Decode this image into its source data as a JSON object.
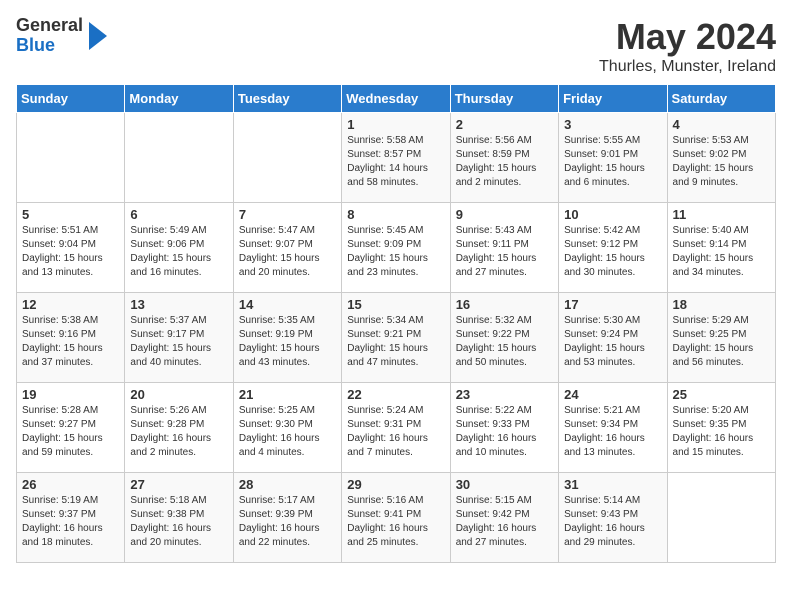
{
  "header": {
    "logo_general": "General",
    "logo_blue": "Blue",
    "month_title": "May 2024",
    "subtitle": "Thurles, Munster, Ireland"
  },
  "days_of_week": [
    "Sunday",
    "Monday",
    "Tuesday",
    "Wednesday",
    "Thursday",
    "Friday",
    "Saturday"
  ],
  "weeks": [
    [
      {
        "day": "",
        "info": ""
      },
      {
        "day": "",
        "info": ""
      },
      {
        "day": "",
        "info": ""
      },
      {
        "day": "1",
        "info": "Sunrise: 5:58 AM\nSunset: 8:57 PM\nDaylight: 14 hours\nand 58 minutes."
      },
      {
        "day": "2",
        "info": "Sunrise: 5:56 AM\nSunset: 8:59 PM\nDaylight: 15 hours\nand 2 minutes."
      },
      {
        "day": "3",
        "info": "Sunrise: 5:55 AM\nSunset: 9:01 PM\nDaylight: 15 hours\nand 6 minutes."
      },
      {
        "day": "4",
        "info": "Sunrise: 5:53 AM\nSunset: 9:02 PM\nDaylight: 15 hours\nand 9 minutes."
      }
    ],
    [
      {
        "day": "5",
        "info": "Sunrise: 5:51 AM\nSunset: 9:04 PM\nDaylight: 15 hours\nand 13 minutes."
      },
      {
        "day": "6",
        "info": "Sunrise: 5:49 AM\nSunset: 9:06 PM\nDaylight: 15 hours\nand 16 minutes."
      },
      {
        "day": "7",
        "info": "Sunrise: 5:47 AM\nSunset: 9:07 PM\nDaylight: 15 hours\nand 20 minutes."
      },
      {
        "day": "8",
        "info": "Sunrise: 5:45 AM\nSunset: 9:09 PM\nDaylight: 15 hours\nand 23 minutes."
      },
      {
        "day": "9",
        "info": "Sunrise: 5:43 AM\nSunset: 9:11 PM\nDaylight: 15 hours\nand 27 minutes."
      },
      {
        "day": "10",
        "info": "Sunrise: 5:42 AM\nSunset: 9:12 PM\nDaylight: 15 hours\nand 30 minutes."
      },
      {
        "day": "11",
        "info": "Sunrise: 5:40 AM\nSunset: 9:14 PM\nDaylight: 15 hours\nand 34 minutes."
      }
    ],
    [
      {
        "day": "12",
        "info": "Sunrise: 5:38 AM\nSunset: 9:16 PM\nDaylight: 15 hours\nand 37 minutes."
      },
      {
        "day": "13",
        "info": "Sunrise: 5:37 AM\nSunset: 9:17 PM\nDaylight: 15 hours\nand 40 minutes."
      },
      {
        "day": "14",
        "info": "Sunrise: 5:35 AM\nSunset: 9:19 PM\nDaylight: 15 hours\nand 43 minutes."
      },
      {
        "day": "15",
        "info": "Sunrise: 5:34 AM\nSunset: 9:21 PM\nDaylight: 15 hours\nand 47 minutes."
      },
      {
        "day": "16",
        "info": "Sunrise: 5:32 AM\nSunset: 9:22 PM\nDaylight: 15 hours\nand 50 minutes."
      },
      {
        "day": "17",
        "info": "Sunrise: 5:30 AM\nSunset: 9:24 PM\nDaylight: 15 hours\nand 53 minutes."
      },
      {
        "day": "18",
        "info": "Sunrise: 5:29 AM\nSunset: 9:25 PM\nDaylight: 15 hours\nand 56 minutes."
      }
    ],
    [
      {
        "day": "19",
        "info": "Sunrise: 5:28 AM\nSunset: 9:27 PM\nDaylight: 15 hours\nand 59 minutes."
      },
      {
        "day": "20",
        "info": "Sunrise: 5:26 AM\nSunset: 9:28 PM\nDaylight: 16 hours\nand 2 minutes."
      },
      {
        "day": "21",
        "info": "Sunrise: 5:25 AM\nSunset: 9:30 PM\nDaylight: 16 hours\nand 4 minutes."
      },
      {
        "day": "22",
        "info": "Sunrise: 5:24 AM\nSunset: 9:31 PM\nDaylight: 16 hours\nand 7 minutes."
      },
      {
        "day": "23",
        "info": "Sunrise: 5:22 AM\nSunset: 9:33 PM\nDaylight: 16 hours\nand 10 minutes."
      },
      {
        "day": "24",
        "info": "Sunrise: 5:21 AM\nSunset: 9:34 PM\nDaylight: 16 hours\nand 13 minutes."
      },
      {
        "day": "25",
        "info": "Sunrise: 5:20 AM\nSunset: 9:35 PM\nDaylight: 16 hours\nand 15 minutes."
      }
    ],
    [
      {
        "day": "26",
        "info": "Sunrise: 5:19 AM\nSunset: 9:37 PM\nDaylight: 16 hours\nand 18 minutes."
      },
      {
        "day": "27",
        "info": "Sunrise: 5:18 AM\nSunset: 9:38 PM\nDaylight: 16 hours\nand 20 minutes."
      },
      {
        "day": "28",
        "info": "Sunrise: 5:17 AM\nSunset: 9:39 PM\nDaylight: 16 hours\nand 22 minutes."
      },
      {
        "day": "29",
        "info": "Sunrise: 5:16 AM\nSunset: 9:41 PM\nDaylight: 16 hours\nand 25 minutes."
      },
      {
        "day": "30",
        "info": "Sunrise: 5:15 AM\nSunset: 9:42 PM\nDaylight: 16 hours\nand 27 minutes."
      },
      {
        "day": "31",
        "info": "Sunrise: 5:14 AM\nSunset: 9:43 PM\nDaylight: 16 hours\nand 29 minutes."
      },
      {
        "day": "",
        "info": ""
      }
    ]
  ]
}
